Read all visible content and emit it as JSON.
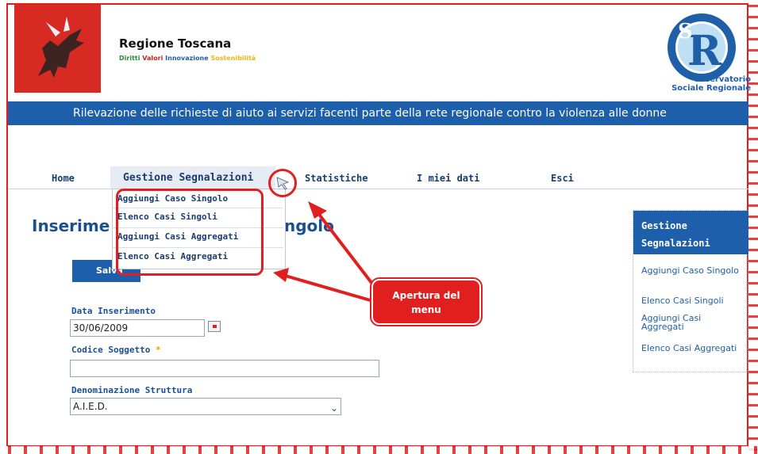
{
  "brand": {
    "title": "Regione Toscana",
    "tagline": [
      "Diritti",
      "Valori",
      "Innovazione",
      "Sostenibilità"
    ]
  },
  "osr": {
    "line1": "Osservatorio",
    "line2": "Sociale Regionale"
  },
  "banner": "Rilevazione delle richieste di aiuto ai servizi facenti parte della rete regionale contro la violenza alle donne",
  "nav": [
    "Home",
    "Gestione Segnalazioni",
    "Statistiche",
    "I miei dati",
    "Esci"
  ],
  "dropdown": [
    "Aggiungi Caso Singolo",
    "Elenco Casi Singoli",
    "Aggiungi Casi Aggregati",
    "Elenco Casi Aggregati"
  ],
  "page": {
    "title_start": "Inserime",
    "title_end": "ngolo"
  },
  "form": {
    "save": "Salva",
    "date_label": "Data Inserimento",
    "date_value": "30/06/2009",
    "code_label": "Codice Soggetto",
    "required_mark": "*",
    "structure_label": "Denominazione Struttura",
    "structure_value": "A.I.E.D."
  },
  "sidebar": {
    "title": "Gestione Segnalazioni",
    "links": [
      "Aggiungi Caso Singolo",
      "Elenco Casi Singoli",
      "Aggiungi Casi Aggregati",
      "Elenco Casi Aggregati"
    ]
  },
  "callout": {
    "line1": "Apertura del",
    "line2": "menu"
  },
  "colors": {
    "accent": "#1d5fab",
    "annotation": "#e21f1f"
  }
}
